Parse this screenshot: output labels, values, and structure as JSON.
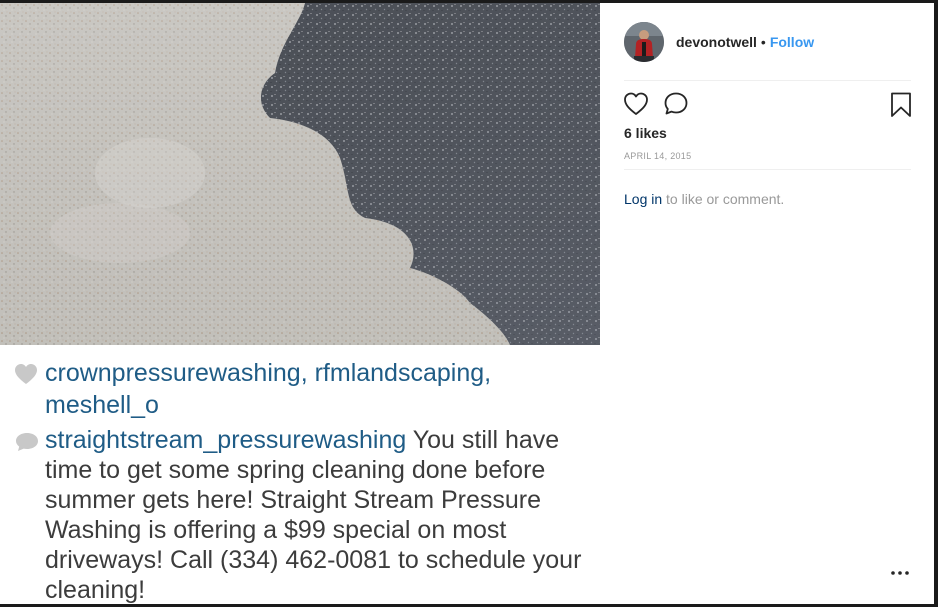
{
  "post": {
    "caption": {
      "likers": [
        "crownpressurewashing",
        "rfmlandscaping",
        "meshell_o"
      ],
      "comment_user": "straightstream_pressurewashing",
      "comment_text": " You still have time to get some spring cleaning done before summer gets here! Straight Stream Pressure Washing is offering a $99 special on most driveways! Call (334) 462-0081 to schedule your cleaning!"
    }
  },
  "sidebar": {
    "username": "devonotwell",
    "separator": "•",
    "follow_label": "Follow",
    "likes": "6 likes",
    "date": "APRIL 14, 2015",
    "login_link": "Log in",
    "login_rest": " to like or comment.",
    "icons": {
      "like": "heart-outline-icon",
      "comment": "speech-bubble-icon",
      "save": "bookmark-icon",
      "more": "ellipsis-icon"
    }
  },
  "colors": {
    "link_blue": "#3897f0",
    "caption_user": "#1f5c86",
    "muted": "#999999",
    "text": "#262626"
  }
}
